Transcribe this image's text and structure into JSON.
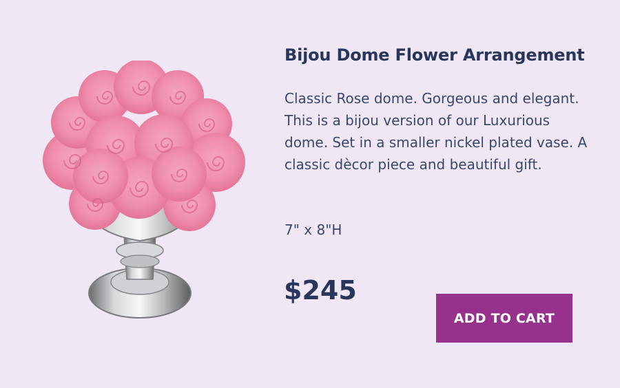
{
  "product": {
    "title": "Bijou Dome Flower Arrangement",
    "description": "Classic Rose dome. Gorgeous and elegant. This is a bijou version of our Luxurious dome. Set in a smaller nickel plated vase. A classic dècor piece and beautiful gift.",
    "dimensions": "7\" x 8\"H",
    "price": "$245",
    "add_to_cart_label": "ADD TO CART"
  },
  "colors": {
    "background": "#f0e7f5",
    "title": "#27365a",
    "button": "#97328c",
    "button_text": "#ffffff"
  },
  "image": {
    "content": "pink-roses-dome-in-silver-vase"
  }
}
